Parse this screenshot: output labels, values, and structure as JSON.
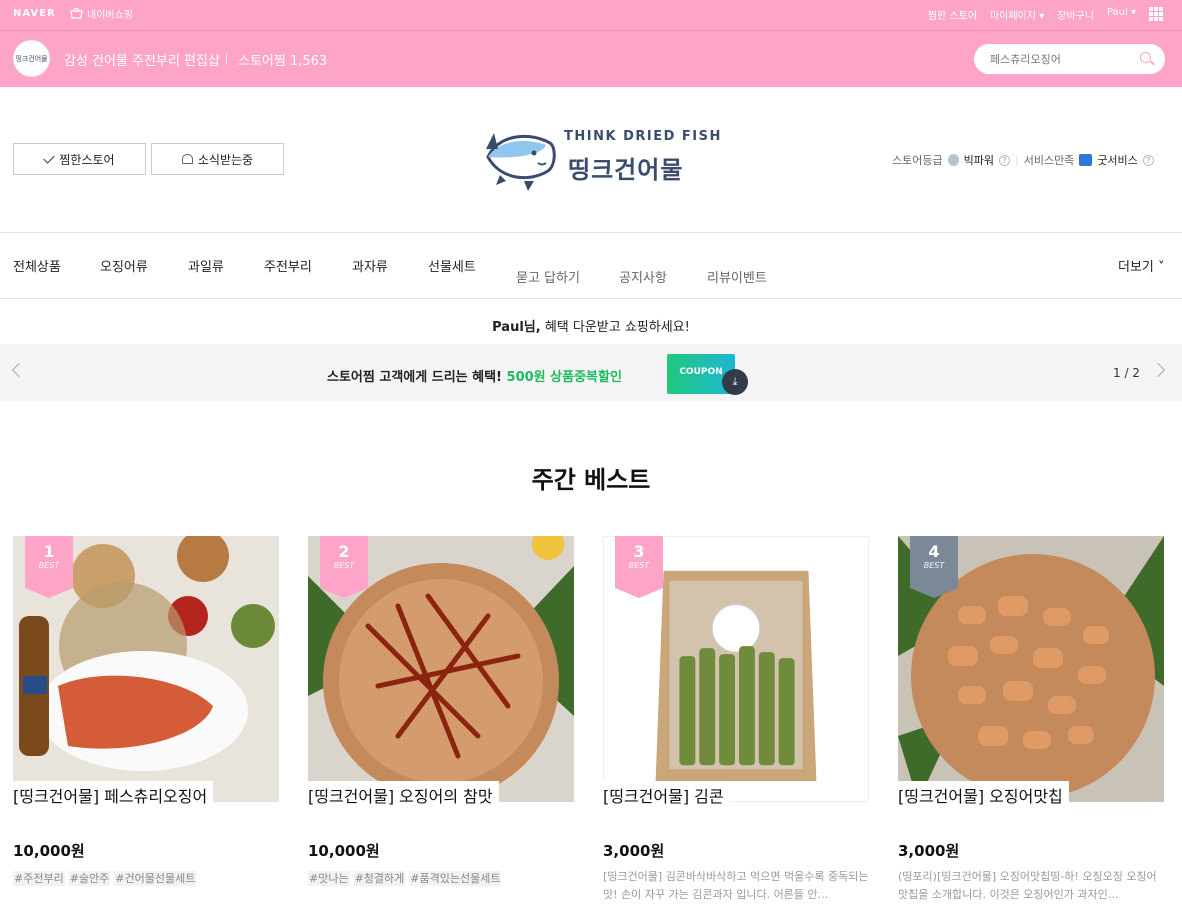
{
  "topbar": {
    "naver": "NAVER",
    "naver_shopping": "네이버쇼핑",
    "links": [
      "찜한 스토어",
      "마이페이지 ▾",
      "장바구니",
      "Paul ▾"
    ]
  },
  "store": {
    "name": "감성 건어물 주전부리 편집샵",
    "favorites": "스토어찜 1,563",
    "logo_text": "띵크건어물",
    "search_placeholder": "페스츄리오징어"
  },
  "actions": {
    "fav_store": "찜한스토어",
    "notify": "소식받는중"
  },
  "brand": {
    "line1": "THINK DRIED FISH",
    "line2": "띵크건어물"
  },
  "rating": {
    "grade_label": "스토어등급",
    "grade_value": "빅파워",
    "service_label": "서비스만족",
    "service_value": "굿서비스"
  },
  "nav": {
    "categories": [
      "전체상품",
      "오징어류",
      "과일류",
      "주전부리",
      "과자류",
      "선물세트"
    ],
    "secondary": [
      "묻고 답하기",
      "공지사항",
      "리뷰이벤트"
    ],
    "more": "더보기 ˅"
  },
  "greeting": {
    "name": "Paul님,",
    "text": " 혜택 다운받고 쇼핑하세요!"
  },
  "banner": {
    "text": "스토어찜 고객에게 드리는 혜택!",
    "highlight": "500원 상품중복할인",
    "coupon": "COUPON",
    "pager": "1 / 2"
  },
  "section_title": "주간 베스트",
  "products": [
    {
      "rank": "1",
      "best": "BEST",
      "name": "[띵크건어물] 페스츄리오징어",
      "price": "10,000원",
      "tags": [
        "#주전부리",
        "#술안주",
        "#건어물선물세트"
      ],
      "desc": ""
    },
    {
      "rank": "2",
      "best": "BEST",
      "name": "[띵크건어물] 오징어의 참맛",
      "price": "10,000원",
      "tags": [
        "#맛나는",
        "#청결하게",
        "#품격있는선물세트"
      ],
      "desc": ""
    },
    {
      "rank": "3",
      "best": "BEST",
      "name": "[띵크건어물] 김콘",
      "price": "3,000원",
      "tags": [],
      "desc": "[띵크건어물] 김콘바삭바삭하고 먹으면 먹을수록 중독되는 맛! 손이 자꾸 가는 김콘과자 입니다. 어른들 안…"
    },
    {
      "rank": "4",
      "best": "BEST",
      "name": "[띵크건어물] 오징어맛칩",
      "price": "3,000원",
      "tags": [],
      "desc": "(띵포리)[띵크건어물] 오징어맛칩띵-하! 오징오징 오징어 맛칩을 소개합니다. 이것은 오징어인가 과자인…"
    }
  ]
}
